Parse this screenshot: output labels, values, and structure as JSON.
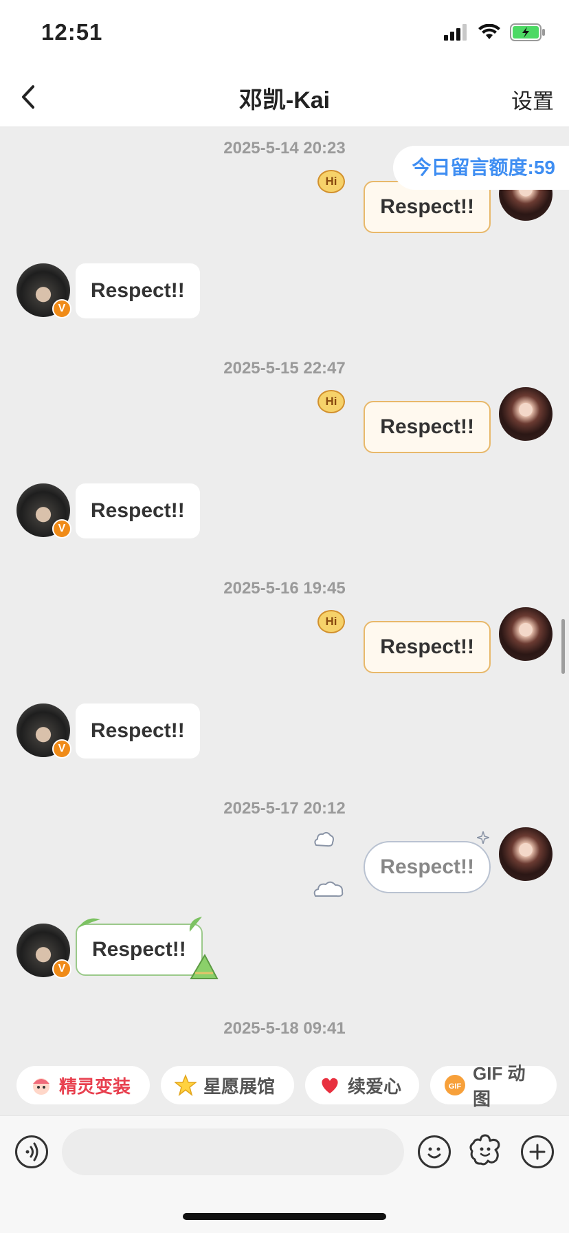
{
  "status_bar": {
    "time": "12:51"
  },
  "nav": {
    "title": "邓凯-Kai",
    "settings": "设置"
  },
  "quota": "今日留言额度:59",
  "messages": [
    {
      "timestamp": "2025-5-14 20:23",
      "sent": "Respect!!",
      "received": "Respect!!"
    },
    {
      "timestamp": "2025-5-15 22:47",
      "sent": "Respect!!",
      "received": "Respect!!"
    },
    {
      "timestamp": "2025-5-16 19:45",
      "sent": "Respect!!",
      "received": "Respect!!"
    },
    {
      "timestamp": "2025-5-17 20:12",
      "sent": "Respect!!",
      "received": "Respect!!"
    },
    {
      "timestamp": "2025-5-18 09:41"
    }
  ],
  "bubble_tag": "Hi",
  "verified_badge": "V",
  "quick_tags": [
    {
      "label": "精灵变装",
      "icon": "elf-icon",
      "color": "#e8404f"
    },
    {
      "label": "星愿展馆",
      "icon": "star-icon",
      "color": "#555555"
    },
    {
      "label": "续爱心",
      "icon": "heart-icon",
      "color": "#555555"
    },
    {
      "label": "GIF 动图",
      "icon": "gif-icon",
      "color": "#555555"
    }
  ],
  "gif_icon_text": "GIF",
  "input": {
    "placeholder": ""
  }
}
